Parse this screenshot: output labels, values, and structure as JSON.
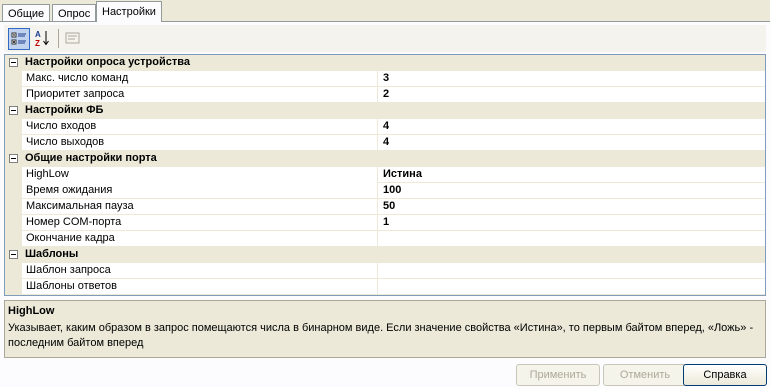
{
  "tabs": [
    {
      "label": "Общие"
    },
    {
      "label": "Опрос"
    },
    {
      "label": "Настройки"
    }
  ],
  "toolbar": {
    "categorized_icon": "categorized-icon",
    "alphabetical_icon": "sort-alphabetical-icon",
    "property_pages_icon": "property-pages-icon"
  },
  "categories": [
    {
      "title": "Настройки опроса устройства",
      "props": [
        {
          "name": "Макс. число команд",
          "value": "3"
        },
        {
          "name": "Приоритет запроса",
          "value": "2"
        }
      ]
    },
    {
      "title": "Настройки ФБ",
      "props": [
        {
          "name": "Число входов",
          "value": "4"
        },
        {
          "name": "Число выходов",
          "value": "4"
        }
      ]
    },
    {
      "title": "Общие настройки порта",
      "props": [
        {
          "name": "HighLow",
          "value": "Истина"
        },
        {
          "name": "Время ожидания",
          "value": "100"
        },
        {
          "name": "Максимальная пауза",
          "value": "50"
        },
        {
          "name": "Номер COM-порта",
          "value": "1"
        },
        {
          "name": "Окончание кадра",
          "value": ""
        }
      ]
    },
    {
      "title": "Шаблоны",
      "props": [
        {
          "name": "Шаблон запроса",
          "value": ""
        },
        {
          "name": "Шаблоны ответов",
          "value": ""
        }
      ]
    }
  ],
  "description": {
    "title": "HighLow",
    "text": "Указывает, каким образом в запрос помещаются числа в бинарном виде. Если значение свойства  «Истина», то первым байтом вперед, «Ложь» - последним байтом вперед"
  },
  "buttons": {
    "apply": "Применить",
    "cancel": "Отменить",
    "help": "Справка"
  }
}
